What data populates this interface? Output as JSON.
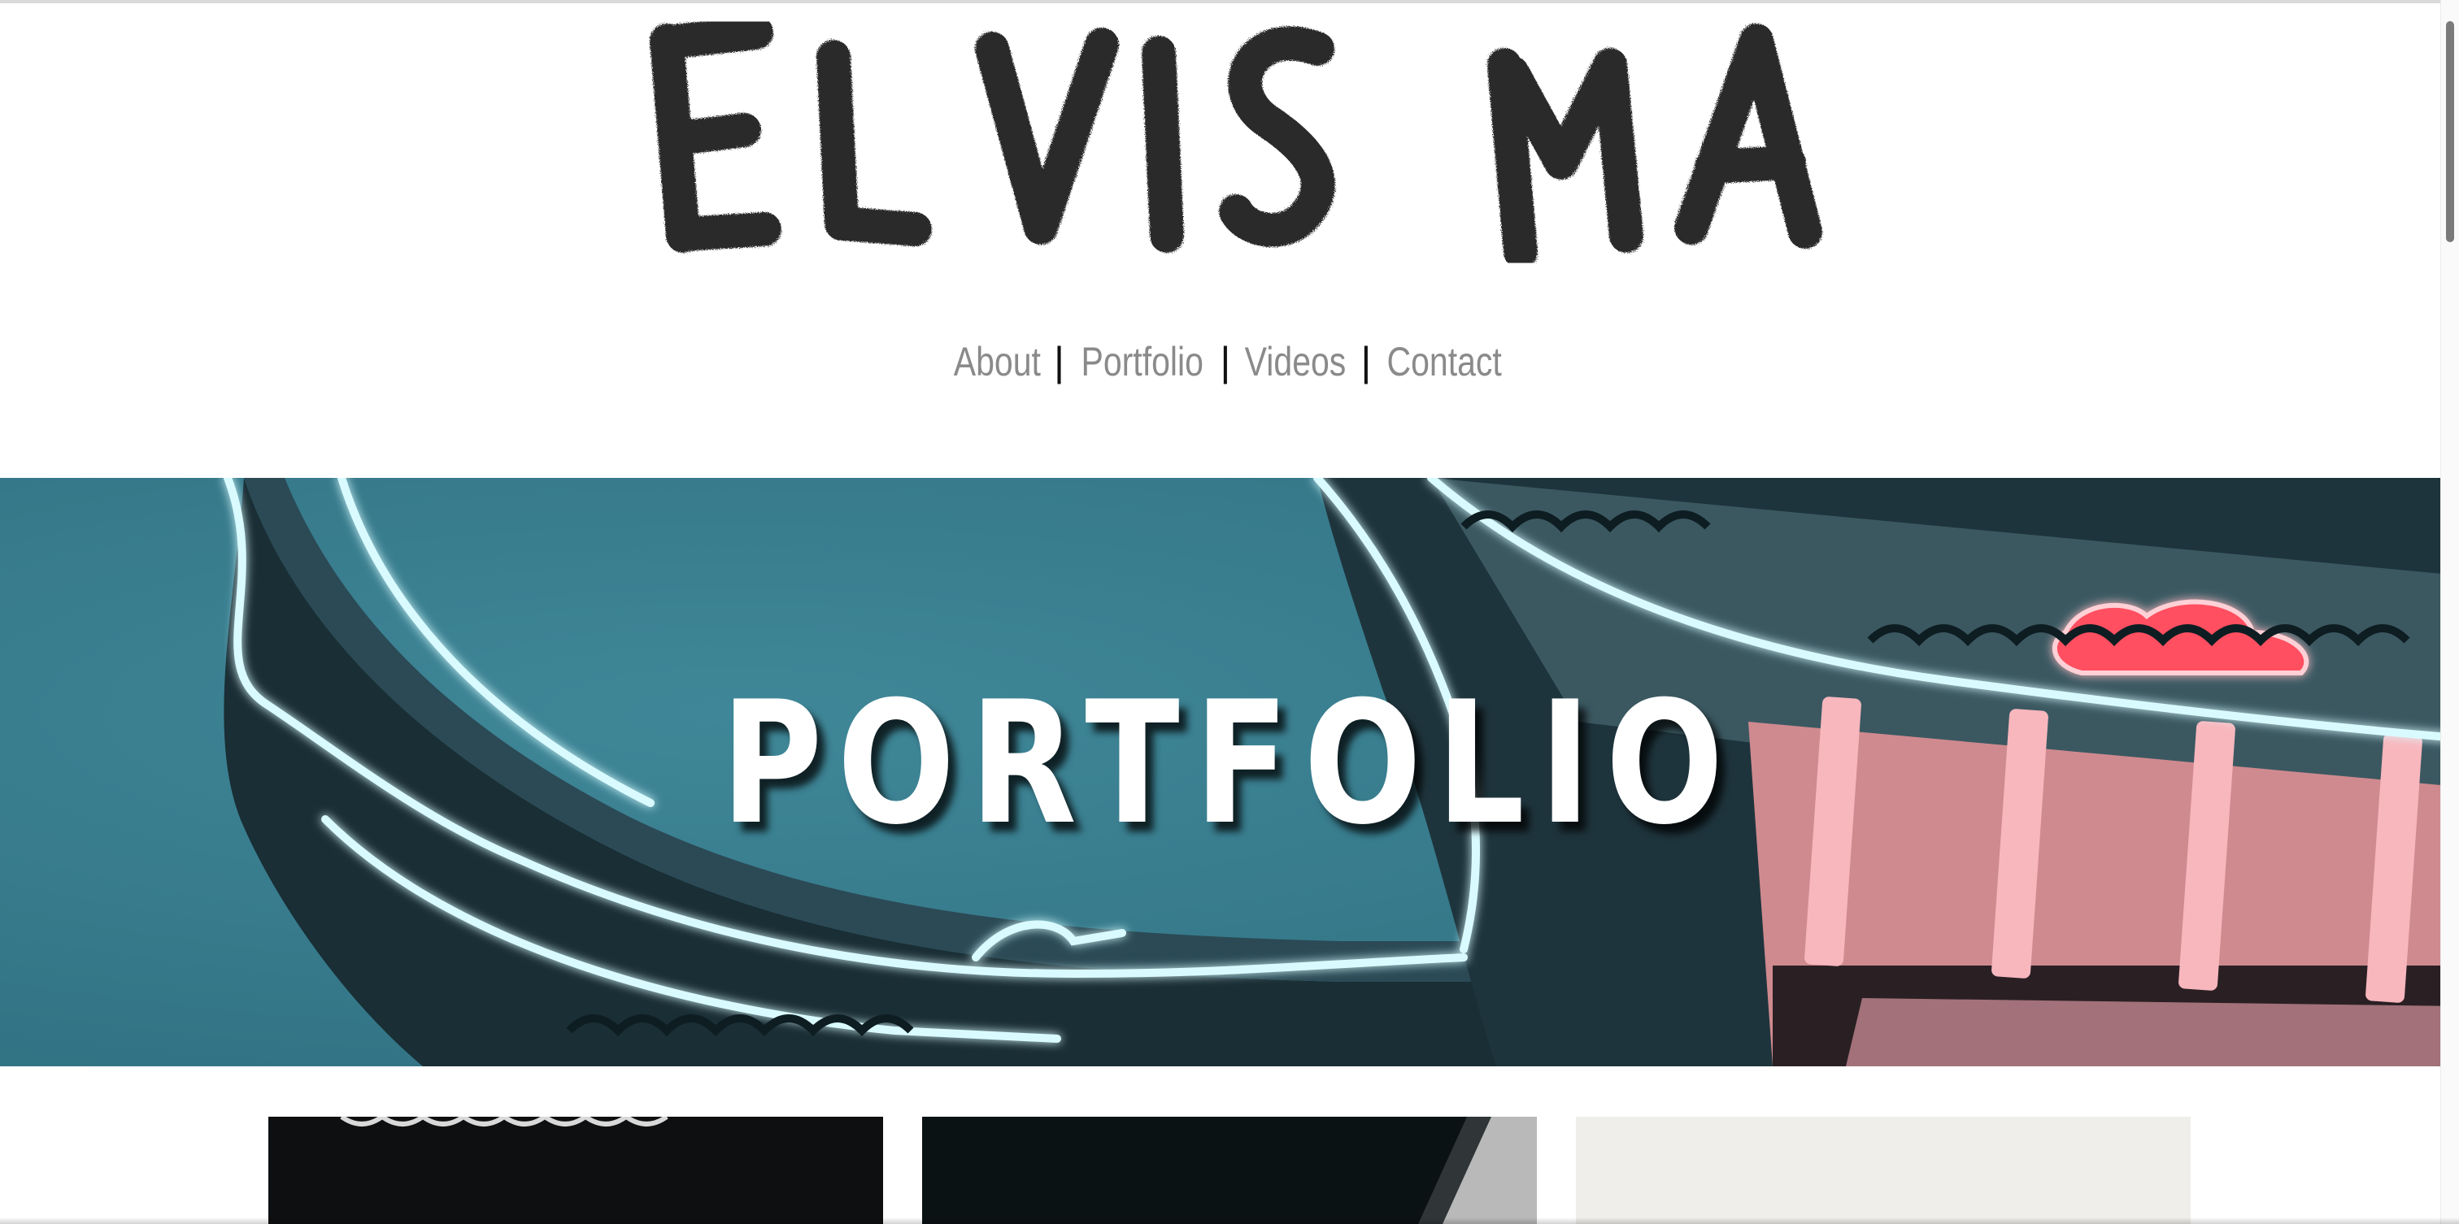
{
  "site": {
    "logo_text": "ELVIS MA"
  },
  "nav": {
    "items": [
      {
        "label": "About"
      },
      {
        "label": "Portfolio"
      },
      {
        "label": "Videos"
      },
      {
        "label": "Contact"
      }
    ],
    "separator": "|"
  },
  "hero": {
    "title": "PORTFOLIO"
  },
  "colors": {
    "nav_link": "#8a8a8a",
    "hero_teal": "#3a8092",
    "neon_blue": "#c8f6ff",
    "neon_red": "#ff4b5c"
  },
  "icons": {
    "logo": "brush-lettering-logo",
    "hero": "neon-sign-image"
  }
}
